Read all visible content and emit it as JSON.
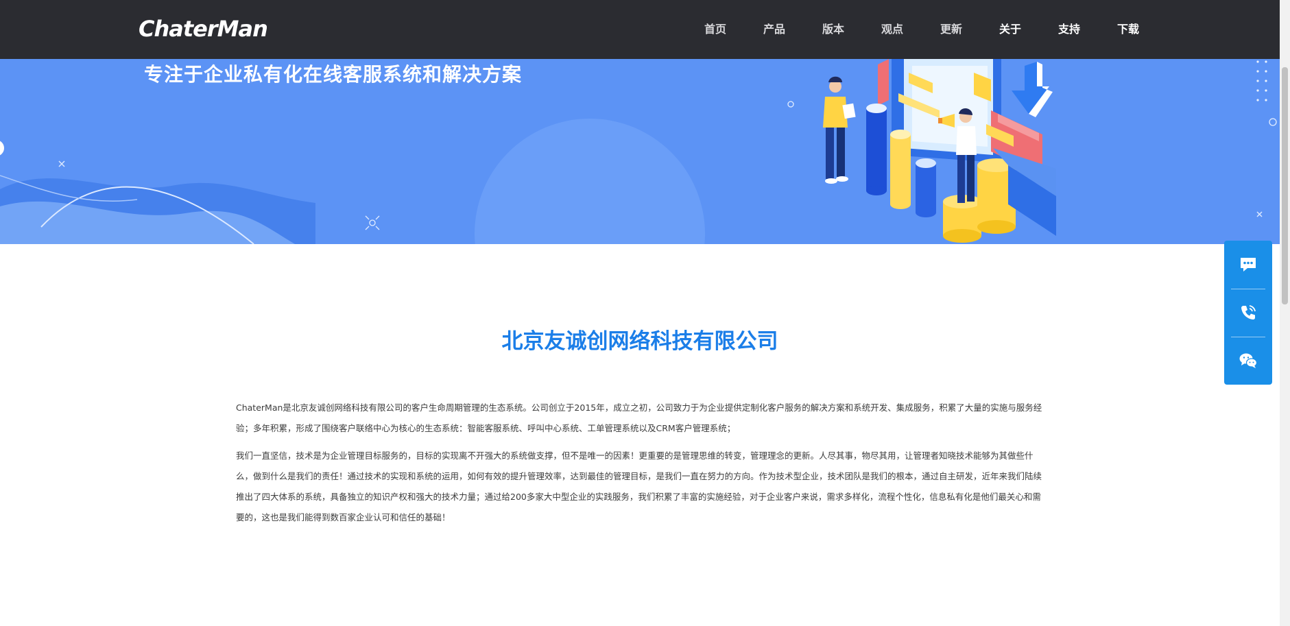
{
  "header": {
    "logo_text": "ChaterMan",
    "nav": [
      {
        "label": "首页"
      },
      {
        "label": "产品"
      },
      {
        "label": "版本"
      },
      {
        "label": "观点"
      },
      {
        "label": "更新"
      },
      {
        "label": "关于"
      },
      {
        "label": "支持"
      },
      {
        "label": "下载"
      }
    ]
  },
  "hero": {
    "tagline": "专注于企业私有化在线客服系统和解决方案"
  },
  "about": {
    "company_name": "北京友诚创网络科技有限公司",
    "paragraphs": [
      "ChaterMan是北京友诚创网络科技有限公司的客户生命周期管理的生态系统。公司创立于2015年，成立之初，公司致力于为企业提供定制化客户服务的解决方案和系统开发、集成服务，积累了大量的实施与服务经验；多年积累，形成了围绕客户联络中心为核心的生态系统：智能客服系统、呼叫中心系统、工单管理系统以及CRM客户管理系统；",
      "我们一直坚信，技术是为企业管理目标服务的，目标的实现离不开强大的系统做支撑，但不是唯一的因素！更重要的是管理思维的转变，管理理念的更新。人尽其事，物尽其用，让管理者知晓技术能够为其做些什么，做到什么是我们的责任！通过技术的实现和系统的运用，如何有效的提升管理效率，达到最佳的管理目标，是我们一直在努力的方向。作为技术型企业，技术团队是我们的根本，通过自主研发，近年来我们陆续推出了四大体系的系统，具备独立的知识产权和强大的技术力量；通过给200多家大中型企业的实践服务，我们积累了丰富的实施经验，对于企业客户来说，需求多样化，流程个性化，信息私有化是他们最关心和需要的，这也是我们能得到数百家企业认可和信任的基础！"
    ]
  },
  "side_panel": {
    "buttons": [
      {
        "icon": "chat-bubbles-icon"
      },
      {
        "icon": "phone-icon"
      },
      {
        "icon": "wechat-icon"
      }
    ]
  },
  "colors": {
    "header_bg": "#2b2c31",
    "hero_bg": "#5c93f5",
    "accent": "#1b7ee8",
    "side_panel": "#1a8fe8"
  }
}
